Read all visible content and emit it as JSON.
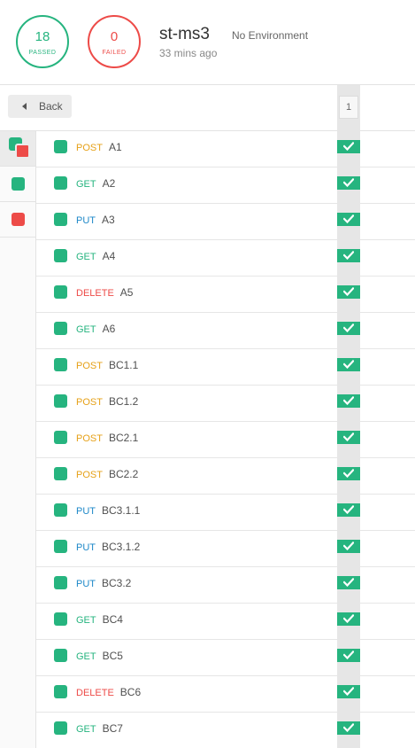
{
  "summary": {
    "passed_count": "18",
    "passed_label": "PASSED",
    "failed_count": "0",
    "failed_label": "FAILED",
    "run_name": "st-ms3",
    "environment": "No Environment",
    "time_ago": "33 mins ago"
  },
  "toolbar": {
    "back_label": "Back",
    "iteration_label": "1"
  },
  "colors": {
    "pass": "#26b47f",
    "fail": "#ed4b48",
    "post": "#e6a118",
    "get": "#26b47f",
    "put": "#1e88c8",
    "delete": "#ed4b48"
  },
  "filters": [
    "filter-all-icon",
    "filter-passed-icon",
    "filter-failed-icon"
  ],
  "requests": [
    {
      "method": "POST",
      "name": "A1",
      "status": "pass"
    },
    {
      "method": "GET",
      "name": "A2",
      "status": "pass"
    },
    {
      "method": "PUT",
      "name": "A3",
      "status": "pass"
    },
    {
      "method": "GET",
      "name": "A4",
      "status": "pass"
    },
    {
      "method": "DELETE",
      "name": "A5",
      "status": "pass"
    },
    {
      "method": "GET",
      "name": "A6",
      "status": "pass"
    },
    {
      "method": "POST",
      "name": "BC1.1",
      "status": "pass"
    },
    {
      "method": "POST",
      "name": "BC1.2",
      "status": "pass"
    },
    {
      "method": "POST",
      "name": "BC2.1",
      "status": "pass"
    },
    {
      "method": "POST",
      "name": "BC2.2",
      "status": "pass"
    },
    {
      "method": "PUT",
      "name": "BC3.1.1",
      "status": "pass"
    },
    {
      "method": "PUT",
      "name": "BC3.1.2",
      "status": "pass"
    },
    {
      "method": "PUT",
      "name": "BC3.2",
      "status": "pass"
    },
    {
      "method": "GET",
      "name": "BC4",
      "status": "pass"
    },
    {
      "method": "GET",
      "name": "BC5",
      "status": "pass"
    },
    {
      "method": "DELETE",
      "name": "BC6",
      "status": "pass"
    },
    {
      "method": "GET",
      "name": "BC7",
      "status": "pass"
    }
  ]
}
